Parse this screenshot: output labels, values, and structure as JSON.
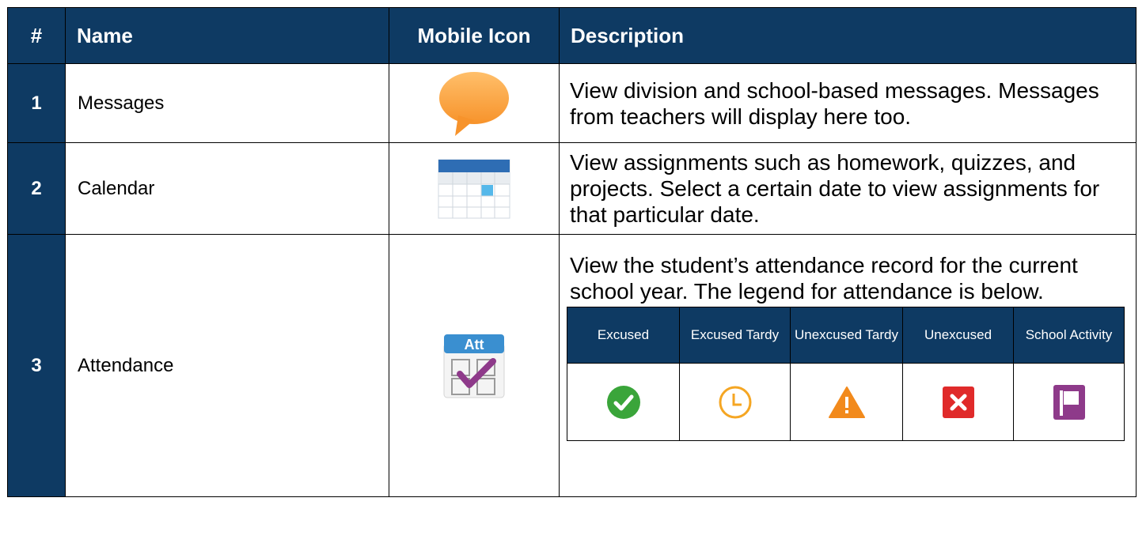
{
  "table": {
    "headers": {
      "num": "#",
      "name": "Name",
      "icon": "Mobile Icon",
      "description": "Description"
    },
    "rows": [
      {
        "num": "1",
        "name": "Messages",
        "icon": "speech-bubble-icon",
        "description": "View division and school-based messages. Messages from teachers will display here too."
      },
      {
        "num": "2",
        "name": "Calendar",
        "icon": "calendar-icon",
        "description": "View assignments such as homework, quizzes, and projects.  Select a certain date to view assignments for that particular date."
      },
      {
        "num": "3",
        "name": "Attendance",
        "icon": "attendance-icon",
        "icon_text": "Att",
        "description": "View the student’s attendance record for the current school year.  The legend for attendance is below."
      }
    ]
  },
  "legend": {
    "items": [
      {
        "label": "Excused",
        "icon": "green-check-icon",
        "color": "#3aa53a"
      },
      {
        "label": "Excused Tardy",
        "icon": "orange-clock-icon",
        "color": "#f5a623"
      },
      {
        "label": "Unexcused Tardy",
        "icon": "orange-warning-icon",
        "color": "#f28a1c"
      },
      {
        "label": "Unexcused",
        "icon": "red-x-icon",
        "color": "#e02a2a"
      },
      {
        "label": "School Activity",
        "icon": "purple-flag-icon",
        "color": "#8e3a8a"
      }
    ]
  },
  "colors": {
    "header_bg": "#0e3a63",
    "header_text": "#ffffff"
  }
}
